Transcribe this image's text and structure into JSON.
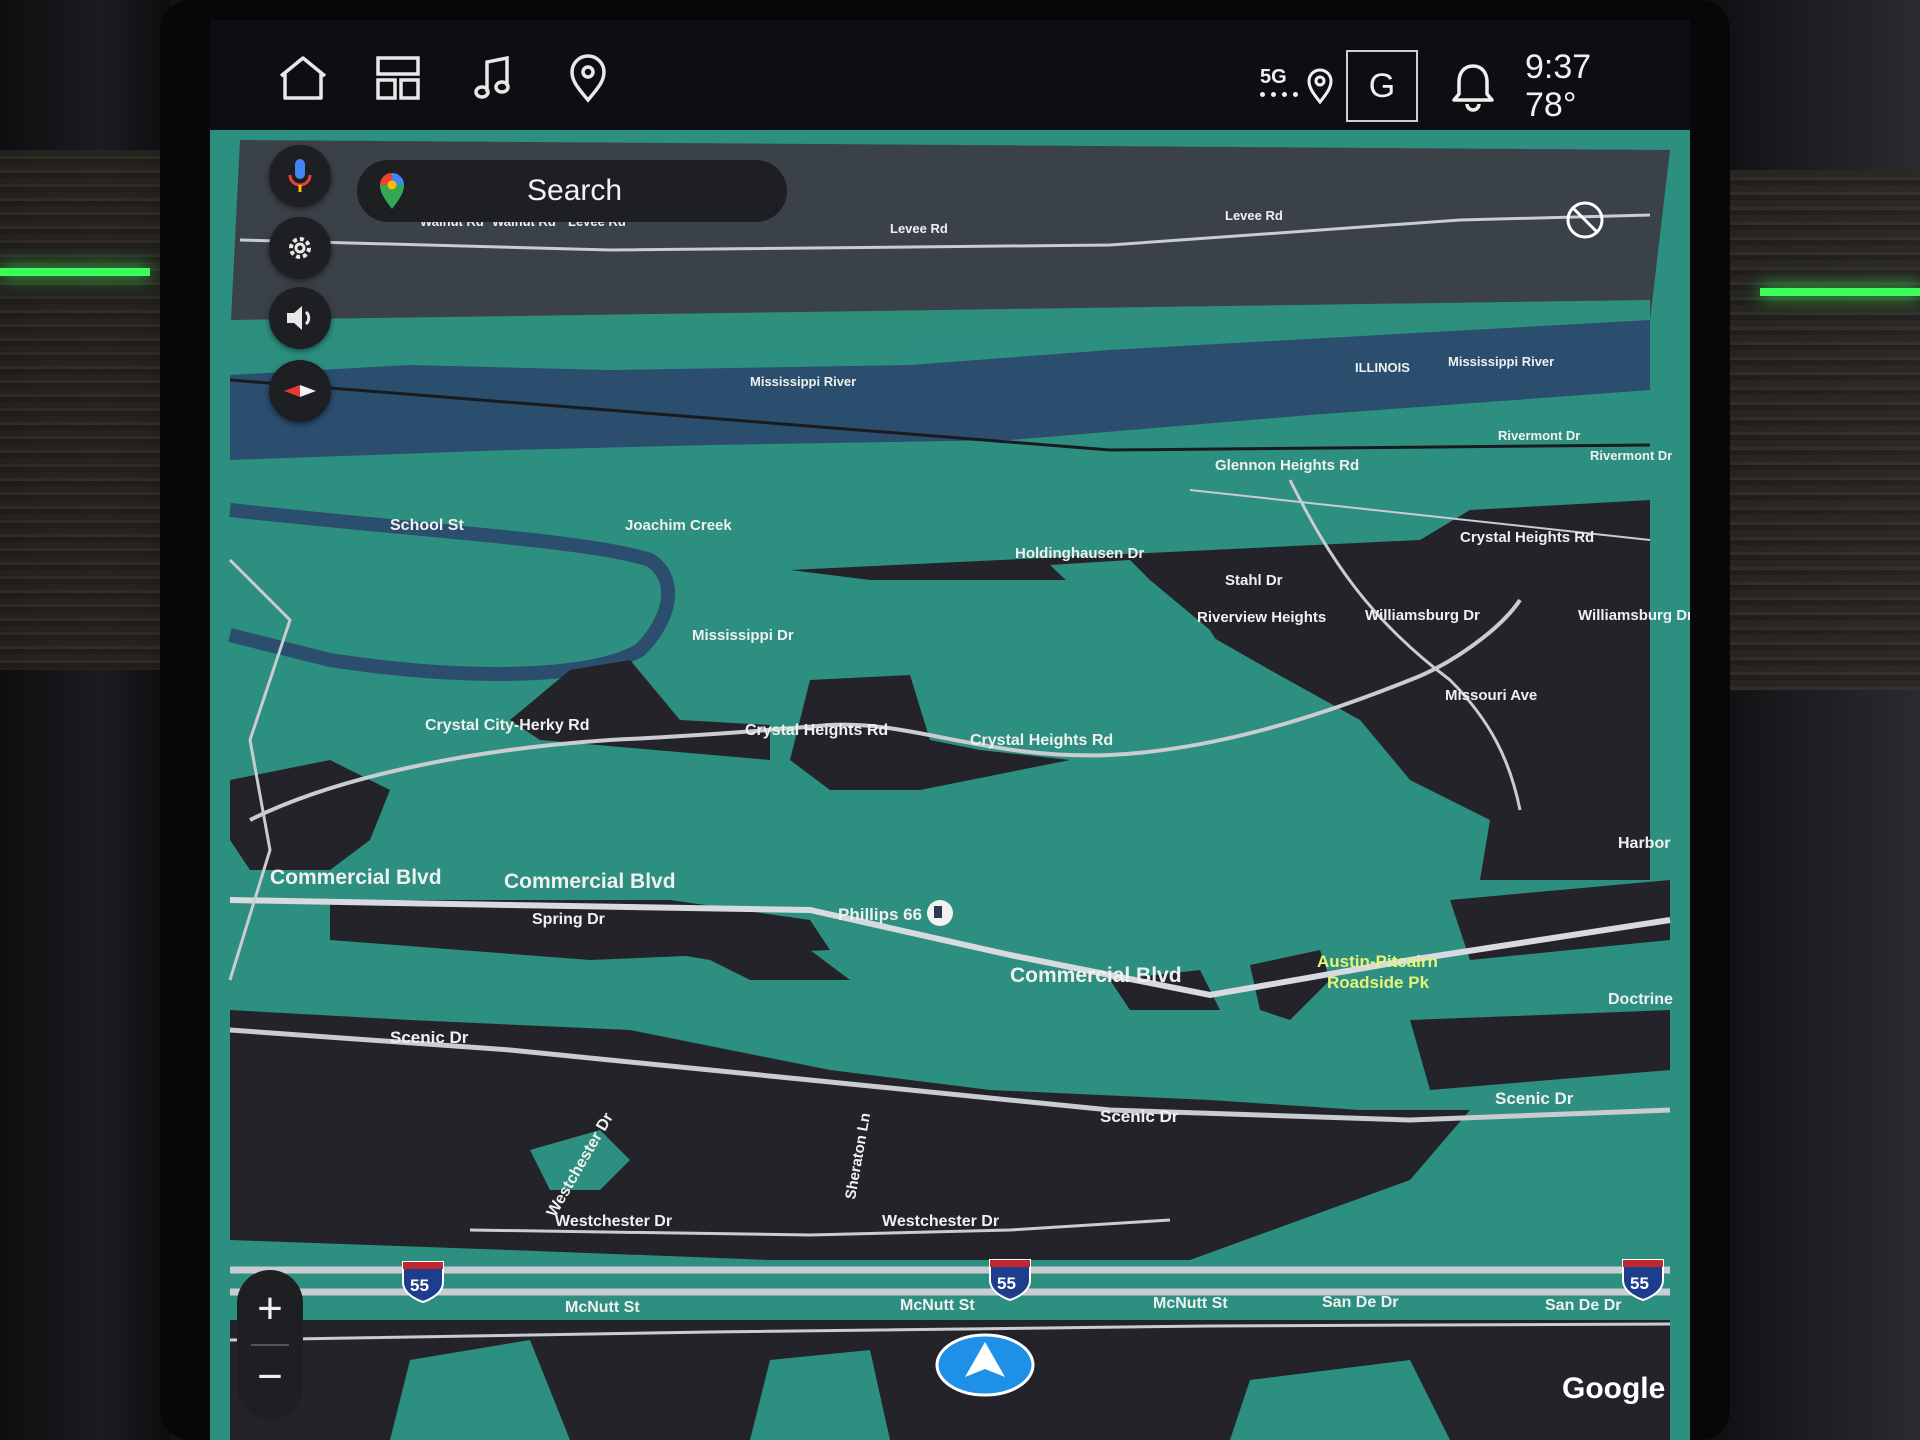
{
  "topbar": {
    "icons": [
      "home-icon",
      "apps-grid-icon",
      "music-note-icon",
      "map-pin-icon"
    ],
    "network": "5G",
    "profile_letter": "G",
    "time": "9:37",
    "temperature": "78°"
  },
  "search": {
    "label": "Search"
  },
  "zoom": {
    "plus": "+",
    "minus": "−"
  },
  "attribution": "Google",
  "colors": {
    "land": "#2c8f7f",
    "water": "#2b4d6e",
    "developed": "#25232a",
    "road": "#c9ccd1"
  },
  "map_labels": {
    "walnut_rd_1": "Walnut Rd",
    "walnut_rd_2": "Walnut Rd",
    "levee_rd_1": "Levee Rd",
    "levee_rd_2": "Levee Rd",
    "levee_rd_3": "Levee Rd",
    "mississippi_river_1": "Mississippi River",
    "mississippi_river_2": "Mississippi River",
    "illinois": "ILLINOIS",
    "rivermont_dr_1": "Rivermont Dr",
    "rivermont_dr_2": "Rivermont Dr",
    "glennon_heights_rd": "Glennon Heights Rd",
    "school_st": "School St",
    "joachim_creek": "Joachim Creek",
    "holdinghausen_dr": "Holdinghausen Dr",
    "stahl_dr": "Stahl Dr",
    "crystal_heights_rd_1": "Crystal Heights Rd",
    "crystal_heights_rd_2": "Crystal Heights Rd",
    "crystal_heights_rd_3": "Crystal Heights Rd",
    "riverview_heights": "Riverview Heights",
    "williamsburg_dr_1": "Williamsburg Dr",
    "williamsburg_dr_2": "Williamsburg Dr",
    "mississippi_dr": "Mississippi Dr",
    "crystal_city_herky_rd": "Crystal City-Herky Rd",
    "missouri_ave": "Missouri Ave",
    "harbor": "Harbor",
    "commercial_blvd_1": "Commercial Blvd",
    "commercial_blvd_2": "Commercial Blvd",
    "commercial_blvd_3": "Commercial Blvd",
    "spring_dr": "Spring Dr",
    "phillips_66": "Phillips 66",
    "austin_pitcairn_1": "Austin-Pitcairn",
    "austin_pitcairn_2": "Roadside Pk",
    "doctrine": "Doctrine",
    "scenic_dr_1": "Scenic Dr",
    "scenic_dr_2": "Scenic Dr",
    "scenic_dr_3": "Scenic Dr",
    "westchester_dr_1": "Westchester Dr",
    "westchester_dr_2": "Westchester Dr",
    "westchester_dr_3": "Westchester Dr",
    "sheraton_ln": "Sheraton Ln",
    "i55": "55",
    "mcnutt_st_1": "McNutt St",
    "mcnutt_st_2": "McNutt St",
    "mcnutt_st_3": "McNutt St",
    "san_de_dr_1": "San De Dr",
    "san_de_dr_2": "San De Dr"
  }
}
